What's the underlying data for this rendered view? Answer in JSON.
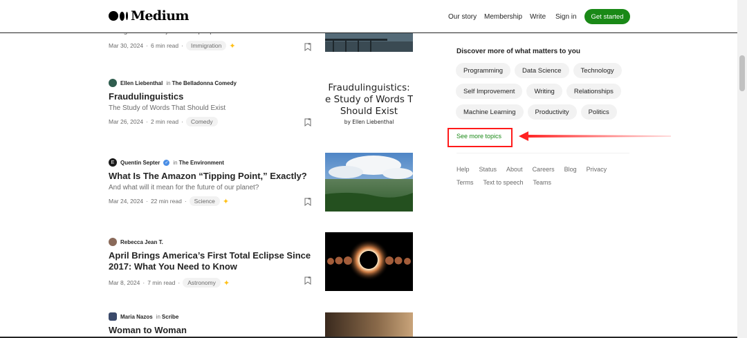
{
  "header": {
    "logo_text": "Medium",
    "nav": [
      "Our story",
      "Membership",
      "Write",
      "Sign in"
    ],
    "cta": "Get started"
  },
  "articles": [
    {
      "subtitle": "Immigrants do the jobs other people don't want to do",
      "date": "Mar 30, 2024",
      "read_time": "6 min read",
      "tag": "Immigration",
      "member_only": true
    },
    {
      "author": "Ellen Liebenthal",
      "in_word": "in",
      "publication": "The Belladonna Comedy",
      "title": "Fraudulinguistics",
      "subtitle": "The Study of Words That Should Exist",
      "date": "Mar 26, 2024",
      "read_time": "2 min read",
      "tag": "Comedy",
      "member_only": false,
      "thumb_title": "Fraudulinguistics:",
      "thumb_line2": "e Study of Words Th",
      "thumb_line3": "Should Exist",
      "thumb_byline": "by Ellen Liebenthal"
    },
    {
      "author": "Quentin Septer",
      "in_word": "in",
      "publication": "The Environment",
      "title": "What Is The Amazon “Tipping Point,” Exactly?",
      "subtitle": "And what will it mean for the future of our planet?",
      "date": "Mar 24, 2024",
      "read_time": "22 min read",
      "tag": "Science",
      "member_only": true
    },
    {
      "author": "Rebecca Jean T.",
      "title_line1": "April Brings America’s First Total Eclipse Since",
      "title_line2": "2017: What You Need to Know",
      "date": "Mar 8, 2024",
      "read_time": "7 min read",
      "tag": "Astronomy",
      "member_only": true
    },
    {
      "author": "Maria Nazos",
      "in_word": "in",
      "publication": "Scribe",
      "title": "Woman to Woman"
    }
  ],
  "sidebar": {
    "discover_title": "Discover more of what matters to you",
    "topics": [
      "Programming",
      "Data Science",
      "Technology",
      "Self Improvement",
      "Writing",
      "Relationships",
      "Machine Learning",
      "Productivity",
      "Politics"
    ],
    "see_more": "See more topics",
    "footer": [
      "Help",
      "Status",
      "About",
      "Careers",
      "Blog",
      "Privacy",
      "Terms",
      "Text to speech",
      "Teams"
    ]
  },
  "colors": {
    "brand_green": "#1a8917",
    "annotation_red": "#ff1a1a",
    "member_star": "#ffc017"
  },
  "icons": [
    "medium-logo-icon",
    "bookmark-icon",
    "member-star-icon",
    "verified-icon",
    "arrow-annotation"
  ]
}
